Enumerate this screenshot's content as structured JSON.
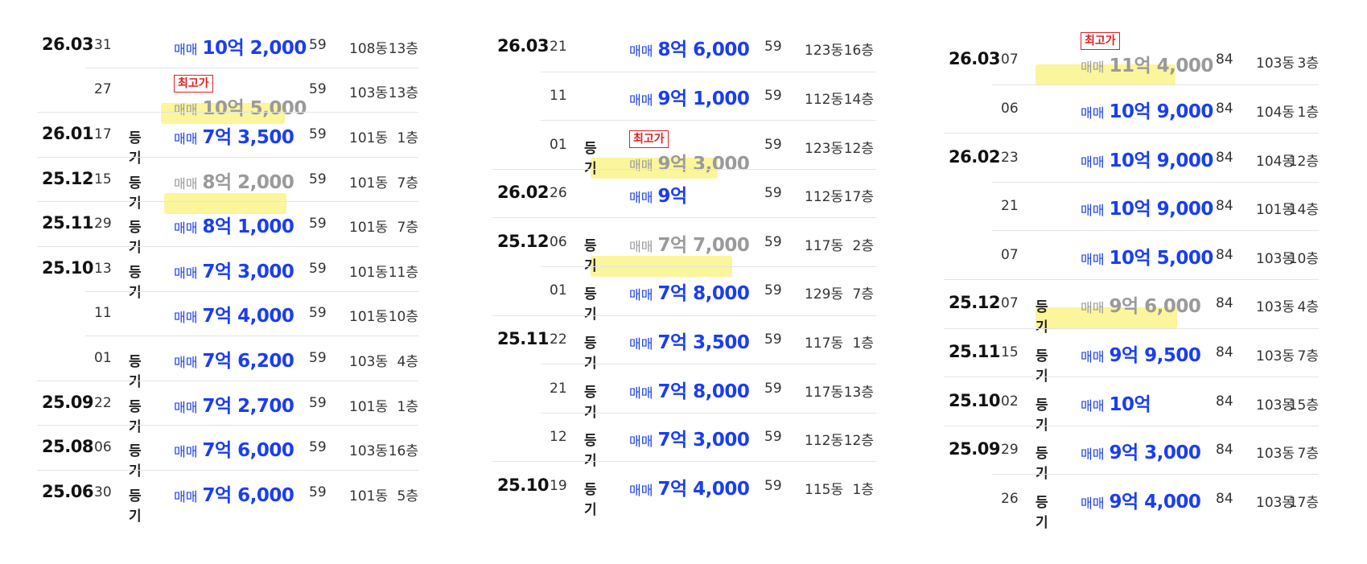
{
  "colors": {
    "price": "#1a3ef0",
    "price_dim": "#9a9a9a",
    "highlight": "#fbf59c",
    "tag": "#dd2222"
  },
  "panels": [
    {
      "rows": [
        {
          "date": "26.03",
          "day": "31",
          "reg": "",
          "kind": "매매",
          "amount": "10억 2,000",
          "area": "59",
          "building": "108동",
          "floor": "13층"
        },
        {
          "date": "",
          "day": "27",
          "reg": "",
          "kind": "매매",
          "amount": "10억 5,000",
          "area": "59",
          "building": "103동",
          "floor": "13층",
          "tag": "최고가",
          "highlight": true
        },
        {
          "date": "26.01",
          "day": "17",
          "reg": "등기",
          "kind": "매매",
          "amount": "7억 3,500",
          "area": "59",
          "building": "101동",
          "floor": "1층"
        },
        {
          "date": "25.12",
          "day": "15",
          "reg": "등기",
          "kind": "매매",
          "amount": "8억 2,000",
          "area": "59",
          "building": "101동",
          "floor": "7층",
          "highlight": true
        },
        {
          "date": "25.11",
          "day": "29",
          "reg": "등기",
          "kind": "매매",
          "amount": "8억 1,000",
          "area": "59",
          "building": "101동",
          "floor": "7층"
        },
        {
          "date": "25.10",
          "day": "13",
          "reg": "등기",
          "kind": "매매",
          "amount": "7억 3,000",
          "area": "59",
          "building": "101동",
          "floor": "11층"
        },
        {
          "date": "",
          "day": "11",
          "reg": "",
          "kind": "매매",
          "amount": "7억 4,000",
          "area": "59",
          "building": "101동",
          "floor": "10층"
        },
        {
          "date": "",
          "day": "01",
          "reg": "등기",
          "kind": "매매",
          "amount": "7억 6,200",
          "area": "59",
          "building": "103동",
          "floor": "4층"
        },
        {
          "date": "25.09",
          "day": "22",
          "reg": "등기",
          "kind": "매매",
          "amount": "7억 2,700",
          "area": "59",
          "building": "101동",
          "floor": "1층"
        },
        {
          "date": "25.08",
          "day": "06",
          "reg": "등기",
          "kind": "매매",
          "amount": "7억 6,000",
          "area": "59",
          "building": "103동",
          "floor": "16층"
        },
        {
          "date": "25.06",
          "day": "30",
          "reg": "등기",
          "kind": "매매",
          "amount": "7억 6,000",
          "area": "59",
          "building": "101동",
          "floor": "5층"
        }
      ]
    },
    {
      "rows": [
        {
          "date": "26.03",
          "day": "21",
          "reg": "",
          "kind": "매매",
          "amount": "8억 6,000",
          "area": "59",
          "building": "123동",
          "floor": "16층"
        },
        {
          "date": "",
          "day": "11",
          "reg": "",
          "kind": "매매",
          "amount": "9억 1,000",
          "area": "59",
          "building": "112동",
          "floor": "14층"
        },
        {
          "date": "",
          "day": "01",
          "reg": "등기",
          "kind": "매매",
          "amount": "9억 3,000",
          "area": "59",
          "building": "123동",
          "floor": "12층",
          "tag": "최고가",
          "highlight": true
        },
        {
          "date": "26.02",
          "day": "26",
          "reg": "",
          "kind": "매매",
          "amount": "9억",
          "area": "59",
          "building": "112동",
          "floor": "17층"
        },
        {
          "date": "25.12",
          "day": "06",
          "reg": "등기",
          "kind": "매매",
          "amount": "7억 7,000",
          "area": "59",
          "building": "117동",
          "floor": "2층",
          "highlight": true
        },
        {
          "date": "",
          "day": "01",
          "reg": "등기",
          "kind": "매매",
          "amount": "7억 8,000",
          "area": "59",
          "building": "129동",
          "floor": "7층"
        },
        {
          "date": "25.11",
          "day": "22",
          "reg": "등기",
          "kind": "매매",
          "amount": "7억 3,500",
          "area": "59",
          "building": "117동",
          "floor": "1층"
        },
        {
          "date": "",
          "day": "21",
          "reg": "등기",
          "kind": "매매",
          "amount": "7억 8,000",
          "area": "59",
          "building": "117동",
          "floor": "13층"
        },
        {
          "date": "",
          "day": "12",
          "reg": "등기",
          "kind": "매매",
          "amount": "7억 3,000",
          "area": "59",
          "building": "112동",
          "floor": "12층"
        },
        {
          "date": "25.10",
          "day": "19",
          "reg": "등기",
          "kind": "매매",
          "amount": "7억 4,000",
          "area": "59",
          "building": "115동",
          "floor": "1층"
        }
      ]
    },
    {
      "rows": [
        {
          "date": "26.03",
          "day": "07",
          "reg": "",
          "kind": "매매",
          "amount": "11억 4,000",
          "area": "84",
          "building": "103동",
          "floor": "3층",
          "tag": "최고가",
          "highlight": true
        },
        {
          "date": "",
          "day": "06",
          "reg": "",
          "kind": "매매",
          "amount": "10억 9,000",
          "area": "84",
          "building": "104동",
          "floor": "1층"
        },
        {
          "date": "26.02",
          "day": "23",
          "reg": "",
          "kind": "매매",
          "amount": "10억 9,000",
          "area": "84",
          "building": "104동",
          "floor": "12층"
        },
        {
          "date": "",
          "day": "21",
          "reg": "",
          "kind": "매매",
          "amount": "10억 9,000",
          "area": "84",
          "building": "101동",
          "floor": "14층"
        },
        {
          "date": "",
          "day": "07",
          "reg": "",
          "kind": "매매",
          "amount": "10억 5,000",
          "area": "84",
          "building": "103동",
          "floor": "10층"
        },
        {
          "date": "25.12",
          "day": "07",
          "reg": "등기",
          "kind": "매매",
          "amount": "9억 6,000",
          "area": "84",
          "building": "103동",
          "floor": "4층",
          "highlight": true
        },
        {
          "date": "25.11",
          "day": "15",
          "reg": "등기",
          "kind": "매매",
          "amount": "9억 9,500",
          "area": "84",
          "building": "103동",
          "floor": "7층"
        },
        {
          "date": "25.10",
          "day": "02",
          "reg": "등기",
          "kind": "매매",
          "amount": "10억",
          "area": "84",
          "building": "103동",
          "floor": "15층"
        },
        {
          "date": "25.09",
          "day": "29",
          "reg": "등기",
          "kind": "매매",
          "amount": "9억 3,000",
          "area": "84",
          "building": "103동",
          "floor": "7층"
        },
        {
          "date": "",
          "day": "26",
          "reg": "등기",
          "kind": "매매",
          "amount": "9억 4,000",
          "area": "84",
          "building": "103동",
          "floor": "17층"
        }
      ]
    }
  ]
}
